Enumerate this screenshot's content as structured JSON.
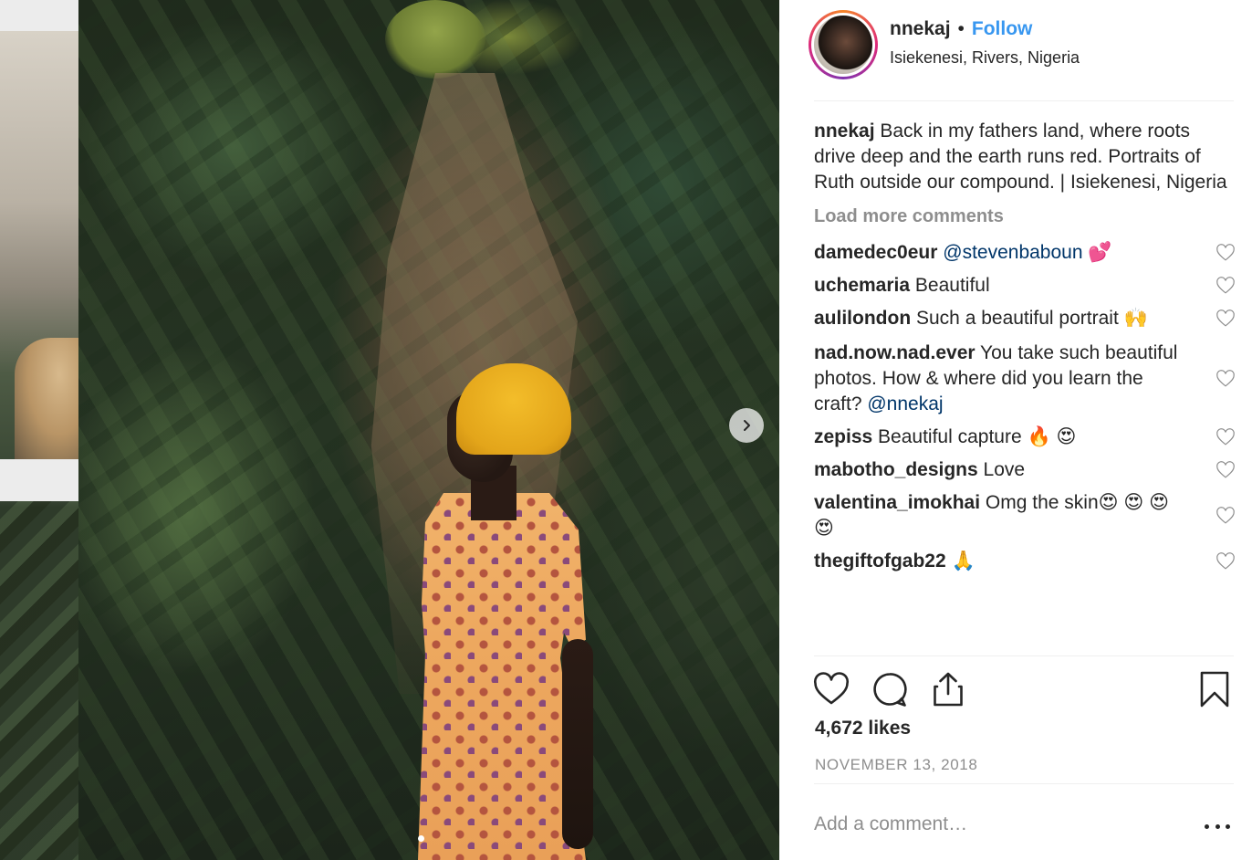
{
  "post": {
    "username": "nnekaj",
    "separator": "•",
    "follow_label": "Follow",
    "location": "Isiekenesi, Rivers, Nigeria",
    "caption_user": "nnekaj",
    "caption_text": "Back in my fathers land, where roots drive deep and the earth runs red. Portraits of Ruth outside our compound. | Isiekenesi, Nigeria",
    "load_more_label": "Load more comments",
    "likes": "4,672 likes",
    "date": "NOVEMBER 13, 2018",
    "add_comment_placeholder": "Add a comment…",
    "carousel": {
      "slide_count": 1,
      "active_slide": 1
    }
  },
  "comments": [
    {
      "user": "damedec0eur",
      "text": " ",
      "mention": "@stevenbaboun",
      "emoji": " 💕"
    },
    {
      "user": "uchemaria",
      "text": " Beautiful",
      "mention": "",
      "emoji": ""
    },
    {
      "user": "aulilondon",
      "text": " Such a beautiful portrait ",
      "mention": "",
      "emoji": "🙌"
    },
    {
      "user": "nad.now.nad.ever",
      "text": " You take such beautiful photos. How & where did you learn the craft? ",
      "mention": "@nnekaj",
      "emoji": ""
    },
    {
      "user": "zepiss",
      "text": " Beautiful capture ",
      "mention": "",
      "emoji": "🔥 😍"
    },
    {
      "user": "mabotho_designs",
      "text": " Love",
      "mention": "",
      "emoji": ""
    },
    {
      "user": "valentina_imokhai",
      "text": " Omg the skin",
      "mention": "",
      "emoji": "😍 😍 😍 😍"
    },
    {
      "user": "thegiftofgab22",
      "text": " ",
      "mention": "",
      "emoji": "🙏"
    }
  ],
  "icons": {
    "like": "heart-icon",
    "comment": "comment-bubble-icon",
    "share": "share-icon",
    "save": "bookmark-icon",
    "next": "chevron-right-icon",
    "options": "more-options-icon"
  },
  "colors": {
    "link_blue": "#3897f0",
    "text": "#262626",
    "muted": "#8e8e8e",
    "mention": "#003569"
  }
}
